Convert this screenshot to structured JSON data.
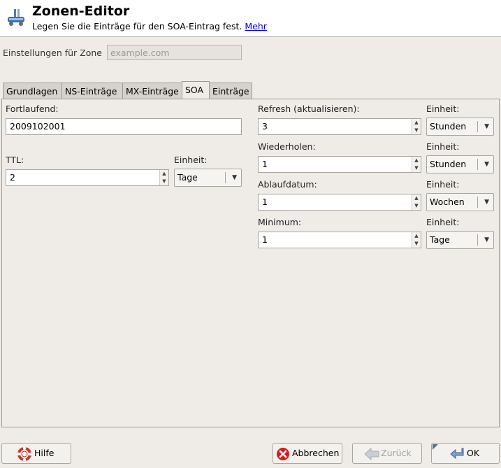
{
  "header": {
    "title": "Zonen-Editor",
    "subtitle": "Legen Sie die Einträge für den SOA-Eintrag fest.",
    "more_link": "Mehr"
  },
  "zone": {
    "label": "Einstellungen für Zone",
    "placeholder": "example.com"
  },
  "tabs": [
    {
      "label": "Grundlagen",
      "active": false
    },
    {
      "label": "NS-Einträge",
      "active": false
    },
    {
      "label": "MX-Einträge",
      "active": false
    },
    {
      "label": "SOA",
      "active": true
    },
    {
      "label": "Einträge",
      "active": false
    }
  ],
  "soa": {
    "serial_label": "Fortlaufend:",
    "serial_value": "2009102001",
    "ttl_label": "TTL:",
    "ttl_value": "2",
    "ttl_unit_label": "Einheit:",
    "ttl_unit": "Tage",
    "refresh_label": "Refresh (aktualisieren):",
    "refresh_value": "3",
    "refresh_unit_label": "Einheit:",
    "refresh_unit": "Stunden",
    "retry_label": "Wiederholen:",
    "retry_value": "1",
    "retry_unit_label": "Einheit:",
    "retry_unit": "Stunden",
    "expire_label": "Ablaufdatum:",
    "expire_value": "1",
    "expire_unit_label": "Einheit:",
    "expire_unit": "Wochen",
    "minimum_label": "Minimum:",
    "minimum_value": "1",
    "minimum_unit_label": "Einheit:",
    "minimum_unit": "Tage"
  },
  "buttons": {
    "help": "Hilfe",
    "cancel": "Abbrechen",
    "back": "Zurück",
    "ok": "OK"
  },
  "icons": {
    "app": "network-dns-icon",
    "help": "lifebuoy-icon",
    "cancel": "cancel-icon",
    "back": "arrow-left-icon",
    "ok": "enter-icon"
  },
  "colors": {
    "window_bg": "#efebe7",
    "link": "#0000ee",
    "cancel_red": "#d11f1f"
  }
}
